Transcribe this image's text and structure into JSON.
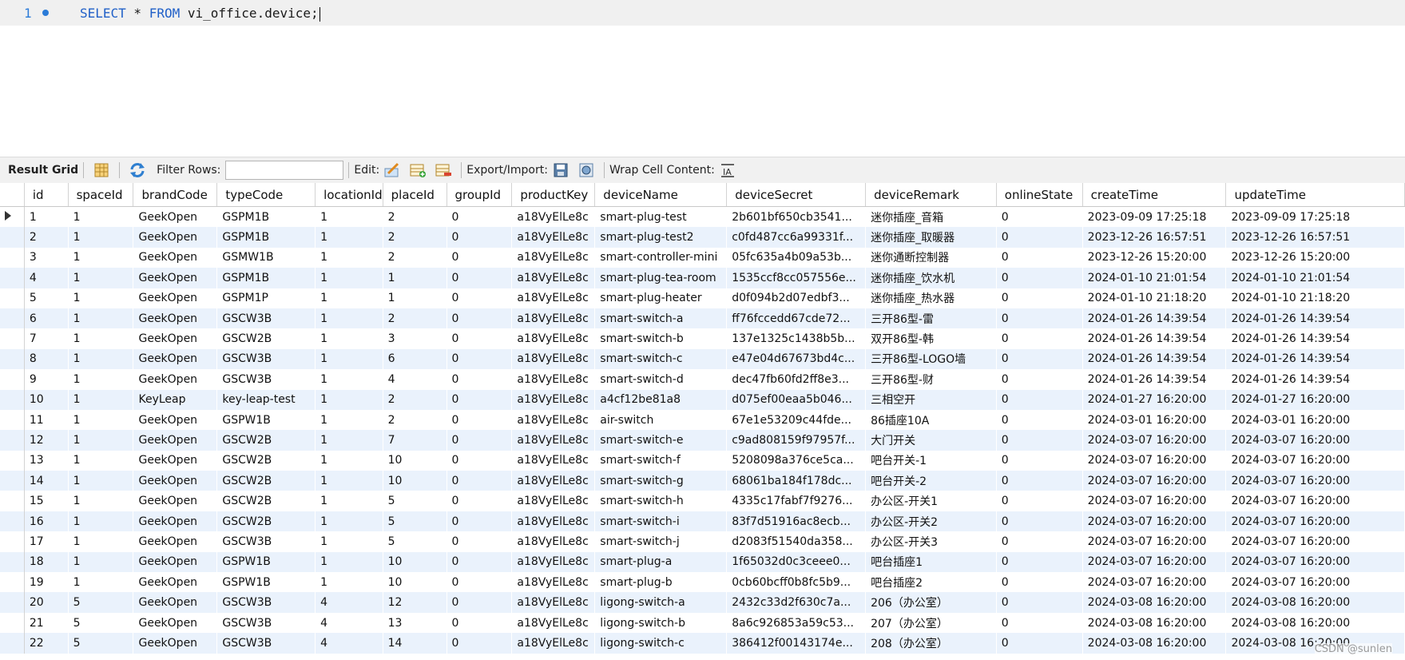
{
  "editor": {
    "line_number": "1",
    "sql_keyword_select": "SELECT",
    "sql_star": " * ",
    "sql_keyword_from": "FROM",
    "sql_table": " vi_office.device;"
  },
  "toolbar": {
    "result_grid": "Result Grid",
    "filter_rows": "Filter Rows:",
    "filter_value": "",
    "edit": "Edit:",
    "export_import": "Export/Import:",
    "wrap_cell": "Wrap Cell Content:"
  },
  "grid": {
    "columns": [
      "id",
      "spaceId",
      "brandCode",
      "typeCode",
      "locationId",
      "placeId",
      "groupId",
      "productKey",
      "deviceName",
      "deviceSecret",
      "deviceRemark",
      "onlineState",
      "createTime",
      "updateTime"
    ],
    "rows": [
      [
        "1",
        "1",
        "GeekOpen",
        "GSPM1B",
        "1",
        "2",
        "0",
        "a18VyElLe8c",
        "smart-plug-test",
        "2b601bf650cb3541...",
        "迷你插座_音箱",
        "0",
        "2023-09-09 17:25:18",
        "2023-09-09 17:25:18"
      ],
      [
        "2",
        "1",
        "GeekOpen",
        "GSPM1B",
        "1",
        "2",
        "0",
        "a18VyElLe8c",
        "smart-plug-test2",
        "c0fd487cc6a99331f...",
        "迷你插座_取暖器",
        "0",
        "2023-12-26 16:57:51",
        "2023-12-26 16:57:51"
      ],
      [
        "3",
        "1",
        "GeekOpen",
        "GSMW1B",
        "1",
        "2",
        "0",
        "a18VyElLe8c",
        "smart-controller-mini",
        "05fc635a4b09a53b...",
        "迷你通断控制器",
        "0",
        "2023-12-26 15:20:00",
        "2023-12-26 15:20:00"
      ],
      [
        "4",
        "1",
        "GeekOpen",
        "GSPM1B",
        "1",
        "1",
        "0",
        "a18VyElLe8c",
        "smart-plug-tea-room",
        "1535ccf8cc057556e...",
        "迷你插座_饮水机",
        "0",
        "2024-01-10 21:01:54",
        "2024-01-10 21:01:54"
      ],
      [
        "5",
        "1",
        "GeekOpen",
        "GSPM1P",
        "1",
        "1",
        "0",
        "a18VyElLe8c",
        "smart-plug-heater",
        "d0f094b2d07edbf3...",
        "迷你插座_热水器",
        "0",
        "2024-01-10 21:18:20",
        "2024-01-10 21:18:20"
      ],
      [
        "6",
        "1",
        "GeekOpen",
        "GSCW3B",
        "1",
        "2",
        "0",
        "a18VyElLe8c",
        "smart-switch-a",
        "ff76fccedd67cde72...",
        "三开86型-雷",
        "0",
        "2024-01-26 14:39:54",
        "2024-01-26 14:39:54"
      ],
      [
        "7",
        "1",
        "GeekOpen",
        "GSCW2B",
        "1",
        "3",
        "0",
        "a18VyElLe8c",
        "smart-switch-b",
        "137e1325c1438b5b...",
        "双开86型-韩",
        "0",
        "2024-01-26 14:39:54",
        "2024-01-26 14:39:54"
      ],
      [
        "8",
        "1",
        "GeekOpen",
        "GSCW3B",
        "1",
        "6",
        "0",
        "a18VyElLe8c",
        "smart-switch-c",
        "e47e04d67673bd4c...",
        "三开86型-LOGO墙",
        "0",
        "2024-01-26 14:39:54",
        "2024-01-26 14:39:54"
      ],
      [
        "9",
        "1",
        "GeekOpen",
        "GSCW3B",
        "1",
        "4",
        "0",
        "a18VyElLe8c",
        "smart-switch-d",
        "dec47fb60fd2ff8e3...",
        "三开86型-财",
        "0",
        "2024-01-26 14:39:54",
        "2024-01-26 14:39:54"
      ],
      [
        "10",
        "1",
        "KeyLeap",
        "key-leap-test",
        "1",
        "2",
        "0",
        "a18VyElLe8c",
        "a4cf12be81a8",
        "d075ef00eaa5b046...",
        "三相空开",
        "0",
        "2024-01-27 16:20:00",
        "2024-01-27 16:20:00"
      ],
      [
        "11",
        "1",
        "GeekOpen",
        "GSPW1B",
        "1",
        "2",
        "0",
        "a18VyElLe8c",
        "air-switch",
        "67e1e53209c44fde...",
        "86插座10A",
        "0",
        "2024-03-01 16:20:00",
        "2024-03-01 16:20:00"
      ],
      [
        "12",
        "1",
        "GeekOpen",
        "GSCW2B",
        "1",
        "7",
        "0",
        "a18VyElLe8c",
        "smart-switch-e",
        "c9ad808159f97957f...",
        "大门开关",
        "0",
        "2024-03-07 16:20:00",
        "2024-03-07 16:20:00"
      ],
      [
        "13",
        "1",
        "GeekOpen",
        "GSCW2B",
        "1",
        "10",
        "0",
        "a18VyElLe8c",
        "smart-switch-f",
        "5208098a376ce5ca...",
        "吧台开关-1",
        "0",
        "2024-03-07 16:20:00",
        "2024-03-07 16:20:00"
      ],
      [
        "14",
        "1",
        "GeekOpen",
        "GSCW2B",
        "1",
        "10",
        "0",
        "a18VyElLe8c",
        "smart-switch-g",
        "68061ba184f178dc...",
        "吧台开关-2",
        "0",
        "2024-03-07 16:20:00",
        "2024-03-07 16:20:00"
      ],
      [
        "15",
        "1",
        "GeekOpen",
        "GSCW2B",
        "1",
        "5",
        "0",
        "a18VyElLe8c",
        "smart-switch-h",
        "4335c17fabf7f9276...",
        "办公区-开关1",
        "0",
        "2024-03-07 16:20:00",
        "2024-03-07 16:20:00"
      ],
      [
        "16",
        "1",
        "GeekOpen",
        "GSCW2B",
        "1",
        "5",
        "0",
        "a18VyElLe8c",
        "smart-switch-i",
        "83f7d51916ac8ecb...",
        "办公区-开关2",
        "0",
        "2024-03-07 16:20:00",
        "2024-03-07 16:20:00"
      ],
      [
        "17",
        "1",
        "GeekOpen",
        "GSCW3B",
        "1",
        "5",
        "0",
        "a18VyElLe8c",
        "smart-switch-j",
        "d2083f51540da358...",
        "办公区-开关3",
        "0",
        "2024-03-07 16:20:00",
        "2024-03-07 16:20:00"
      ],
      [
        "18",
        "1",
        "GeekOpen",
        "GSPW1B",
        "1",
        "10",
        "0",
        "a18VyElLe8c",
        "smart-plug-a",
        "1f65032d0c3ceee0...",
        "吧台插座1",
        "0",
        "2024-03-07 16:20:00",
        "2024-03-07 16:20:00"
      ],
      [
        "19",
        "1",
        "GeekOpen",
        "GSPW1B",
        "1",
        "10",
        "0",
        "a18VyElLe8c",
        "smart-plug-b",
        "0cb60bcff0b8fc5b9...",
        "吧台插座2",
        "0",
        "2024-03-07 16:20:00",
        "2024-03-07 16:20:00"
      ],
      [
        "20",
        "5",
        "GeekOpen",
        "GSCW3B",
        "4",
        "12",
        "0",
        "a18VyElLe8c",
        "ligong-switch-a",
        "2432c33d2f630c7a...",
        "206（办公室）",
        "0",
        "2024-03-08 16:20:00",
        "2024-03-08 16:20:00"
      ],
      [
        "21",
        "5",
        "GeekOpen",
        "GSCW3B",
        "4",
        "13",
        "0",
        "a18VyElLe8c",
        "ligong-switch-b",
        "8a6c926853a59c53...",
        "207（办公室）",
        "0",
        "2024-03-08 16:20:00",
        "2024-03-08 16:20:00"
      ],
      [
        "22",
        "5",
        "GeekOpen",
        "GSCW3B",
        "4",
        "14",
        "0",
        "a18VyElLe8c",
        "ligong-switch-c",
        "386412f00143174e...",
        "208（办公室）",
        "0",
        "2024-03-08 16:20:00",
        "2024-03-08 16:20:00"
      ]
    ]
  },
  "icons": {
    "grid_view": "grid-view-icon",
    "refresh": "refresh-icon",
    "edit_row": "edit-row-icon",
    "insert_row": "insert-row-icon",
    "delete_row": "delete-row-icon",
    "export": "export-icon",
    "import": "import-icon",
    "wrap": "wrap-cell-icon"
  },
  "colors": {
    "keyword": "#2060c8",
    "line_number": "#2b7bd8",
    "alt_row": "#eaf2fc"
  },
  "watermark": "CSDN @sunlen"
}
